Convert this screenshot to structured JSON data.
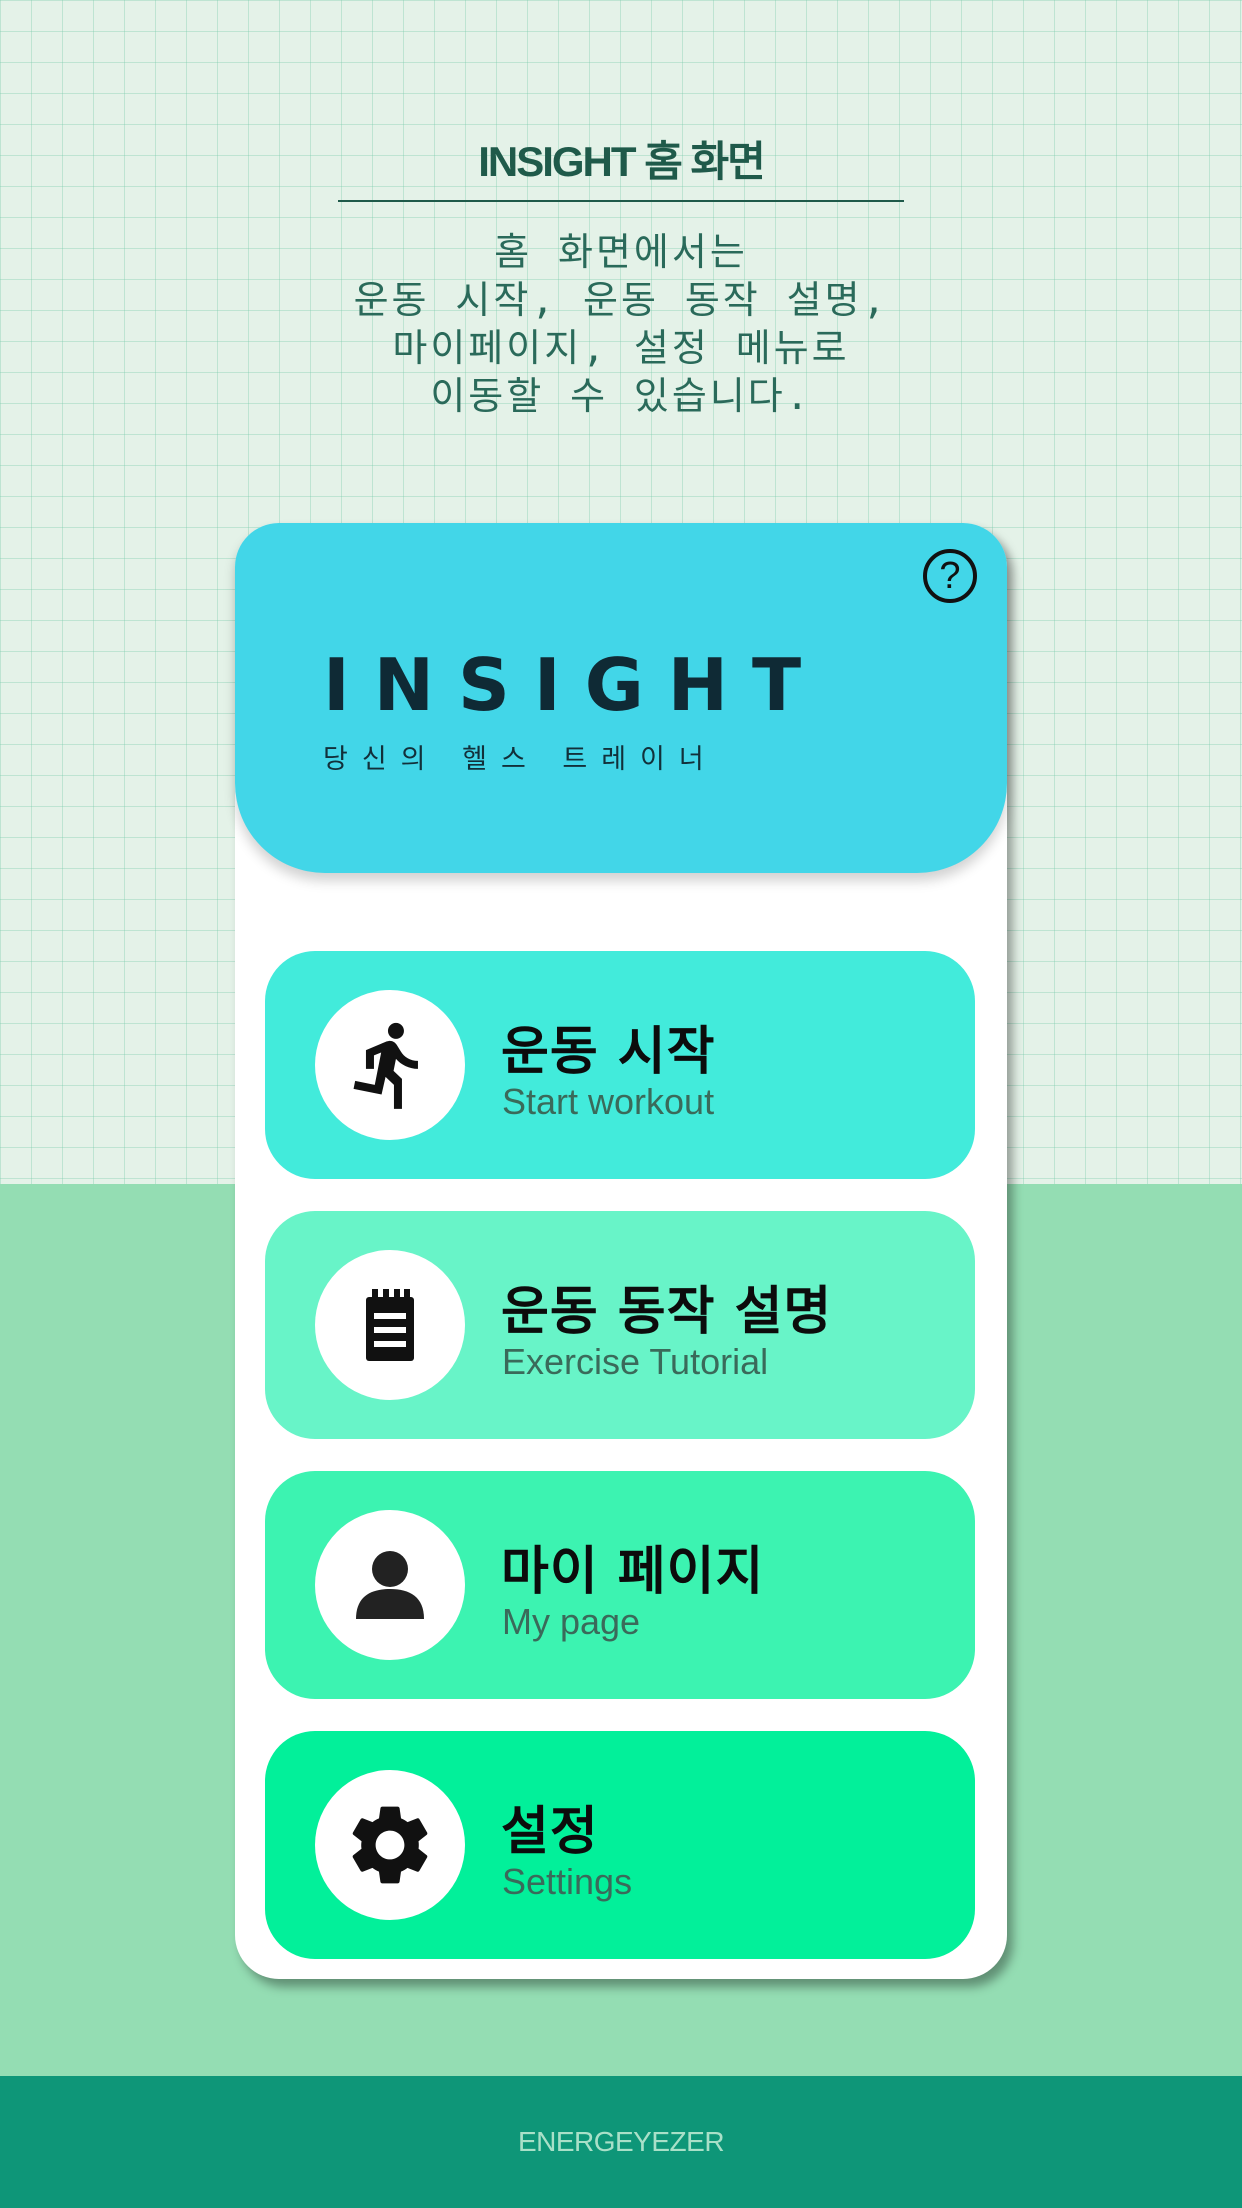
{
  "header": {
    "title": "INSIGHT 홈 화면",
    "description_lines": [
      "홈 화면에서는",
      "운동 시작, 운동 동작 설명,",
      "마이페이지, 설정 메뉴로",
      "이동할 수 있습니다."
    ]
  },
  "app": {
    "help_icon": "question-circle-icon",
    "help_label": "?",
    "brand": "INSIGHT",
    "tagline": "당신의 헬스 트레이너"
  },
  "menu": [
    {
      "title": "운동 시작",
      "subtitle": "Start workout",
      "icon": "running-person-icon",
      "color": "#42ebdb"
    },
    {
      "title": "운동 동작 설명",
      "subtitle": "Exercise Tutorial",
      "icon": "notepad-icon",
      "color": "#68f4c8"
    },
    {
      "title": "마이 페이지",
      "subtitle": "My page",
      "icon": "person-icon",
      "color": "#3cf3b1"
    },
    {
      "title": "설정",
      "subtitle": "Settings",
      "icon": "gear-icon",
      "color": "#02f09a"
    }
  ],
  "footer": {
    "text": "ENERGEYEZER"
  },
  "colors": {
    "hero": "#42d6e8",
    "footer": "#0e9678",
    "band": "#94ddb3"
  }
}
